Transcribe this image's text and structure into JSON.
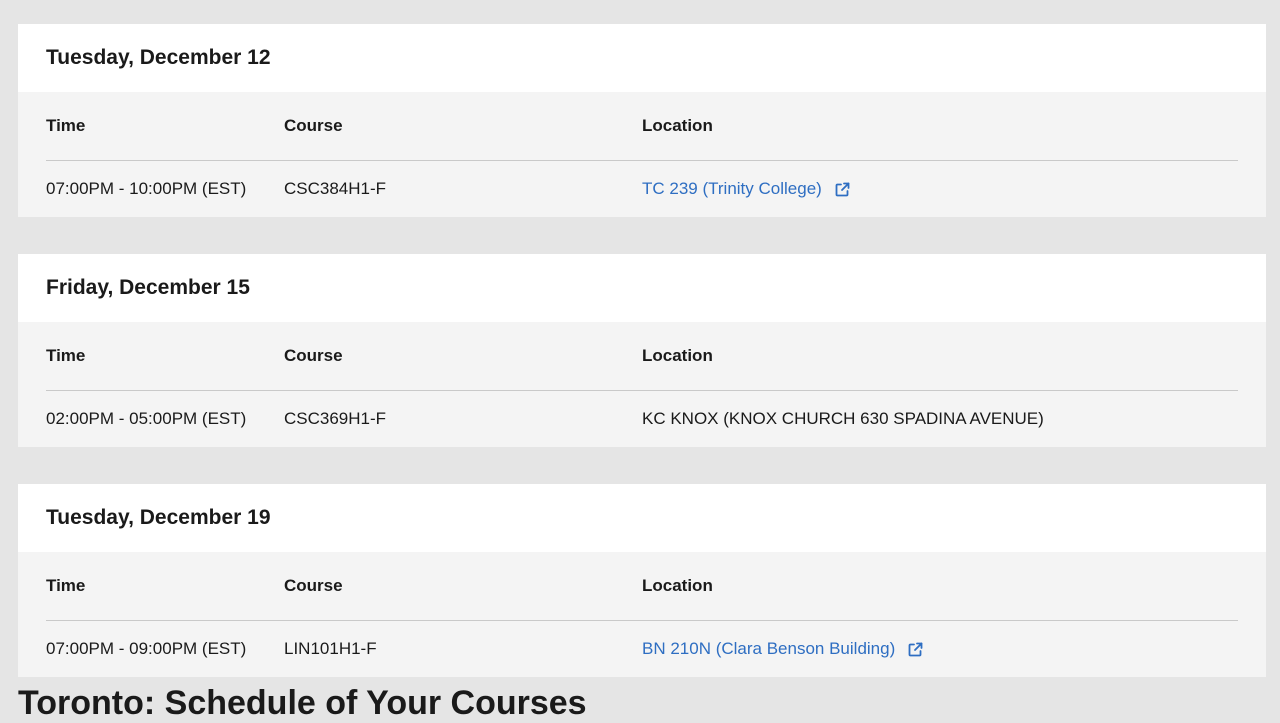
{
  "columns": {
    "time": "Time",
    "course": "Course",
    "location": "Location"
  },
  "exams": [
    {
      "date": "Tuesday, December 12",
      "time": "07:00PM - 10:00PM (EST)",
      "course": "CSC384H1-F",
      "location": "TC 239 (Trinity College)",
      "location_is_link": true
    },
    {
      "date": "Friday, December 15",
      "time": "02:00PM - 05:00PM (EST)",
      "course": "CSC369H1-F",
      "location": "KC KNOX (KNOX CHURCH 630 SPADINA AVENUE)",
      "location_is_link": false
    },
    {
      "date": "Tuesday, December 19",
      "time": "07:00PM - 09:00PM (EST)",
      "course": "LIN101H1-F",
      "location": "BN 210N (Clara Benson Building)",
      "location_is_link": true
    }
  ],
  "footer_heading": "Toronto: Schedule of Your Courses",
  "icons": {
    "external": "external-link-icon"
  },
  "colors": {
    "link": "#2e6ec2",
    "card_body": "#f4f4f4",
    "card_header": "#ffffff",
    "page_bg": "#e5e5e5"
  }
}
